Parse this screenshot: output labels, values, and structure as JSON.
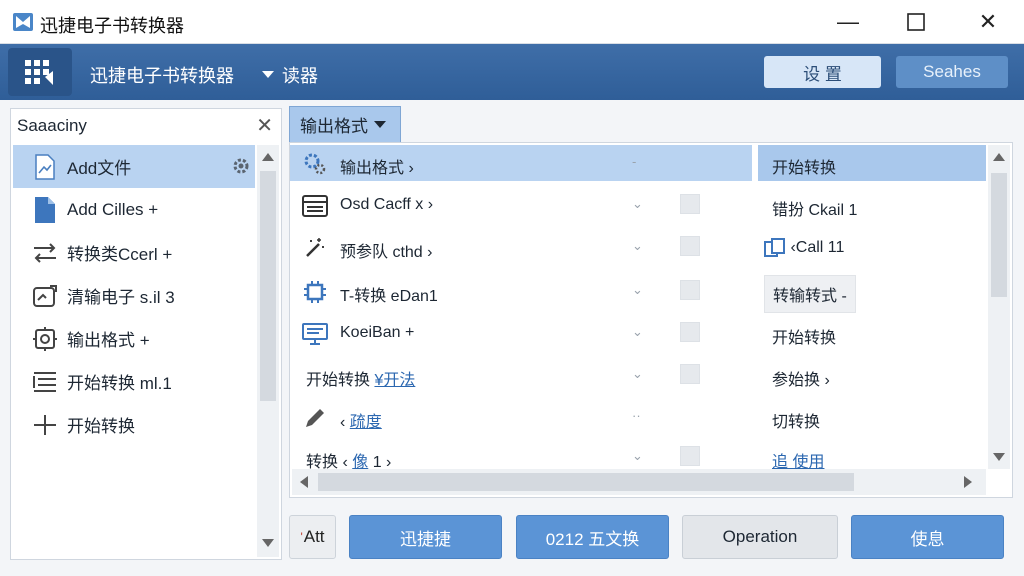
{
  "window": {
    "title": "迅捷电子书转换器",
    "minimize_glyph": "—",
    "maximize_glyph": "☐",
    "close_glyph": "✕"
  },
  "toolbar": {
    "app_title": "迅捷电子书转换器",
    "dropdown_label": "读器",
    "button_left": "设 置",
    "button_right": "Seahes"
  },
  "sidebar": {
    "title": "Saaaciny",
    "items": [
      {
        "label": "Add文件",
        "icon": "document-icon"
      },
      {
        "label": "Add Cilles +",
        "icon": "file-icon"
      },
      {
        "label": "转换类Ccerl +",
        "icon": "convert-icon"
      },
      {
        "label": "清输电子 s.il 3",
        "icon": "image-icon"
      },
      {
        "label": "输出格式 +",
        "icon": "settings-icon"
      },
      {
        "label": "开始转换 ml.1",
        "icon": "list-icon"
      },
      {
        "label": "开始转换",
        "icon": "split-icon"
      }
    ]
  },
  "main": {
    "tab_label": "输出格式",
    "rows": [
      {
        "icon": "gear-icon",
        "name": "输出格式 ›",
        "chevron": "-",
        "right": "开始转换"
      },
      {
        "icon": "window-icon",
        "name": "Osd Cacff x ›",
        "chevron": "⌄",
        "right": "错扮 Ckail 1"
      },
      {
        "icon": "magic-icon",
        "name": "预参队 cthd ›",
        "chevron": "⌄",
        "right": "‹Call 11"
      },
      {
        "icon": "chip-icon",
        "name": "T-转换 eDan1",
        "chevron": "⌄",
        "right": "转输转式 -"
      },
      {
        "icon": "monitor-icon",
        "name": "KoeiBan +",
        "chevron": "⌄",
        "right": "开始转换"
      },
      {
        "icon": "",
        "name": "开始转换 ",
        "name_link": "¥开法",
        "chevron": "⌄",
        "right": "参始换 ›"
      },
      {
        "icon": "pencil-icon",
        "name": "‹ ",
        "name_link": "疏度",
        "chevron": "··",
        "right": "切转换"
      },
      {
        "icon": "",
        "name": "转换 ‹ ",
        "name_link": "  像",
        "name_tail": " 1 ›",
        "chevron": "⌄",
        "right": "追 使用"
      }
    ]
  },
  "bottom": {
    "att_label": "Att",
    "btn1": "迅捷捷",
    "btn2": "0212 五文换",
    "btn3": "Operation",
    "btn4": "使息"
  },
  "colors": {
    "toolbar": "#3a69a3",
    "selection": "#b9d3f1",
    "primary_button": "#5b94d6",
    "link": "#2b67b0"
  }
}
